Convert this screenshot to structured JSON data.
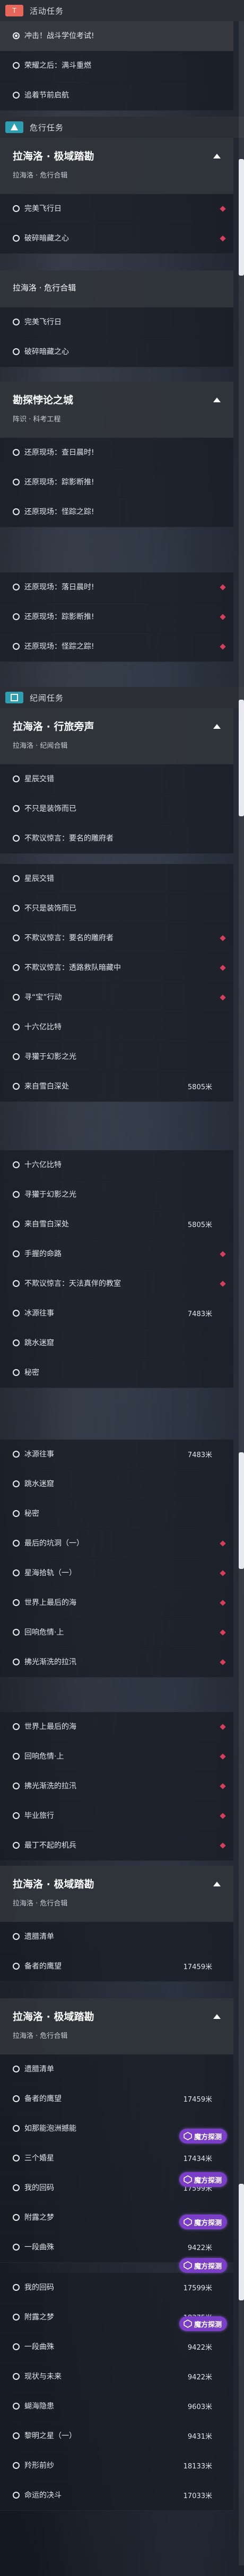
{
  "sections": {
    "activity": {
      "tag": "T",
      "title": "活动任务",
      "tag_color": "#e8665a"
    },
    "danger": {
      "title": "危行任务",
      "tag_color": "#2e9fb0"
    },
    "record": {
      "title": "纪闻任务",
      "tag_color": "#2e9fb0"
    }
  },
  "quest_states": {
    "badge_text": "魔方探测",
    "accent_color": "#d7405a",
    "badge_color": "#7a3fc6"
  },
  "rows": [
    {
      "t": "冲击！战斗学位考试!",
      "sel": true
    },
    {
      "t": "荣耀之后：满斗重燃"
    },
    {
      "t": "追着节前启航"
    },
    {
      "t": "完美飞行日",
      "pin": true
    },
    {
      "t": "破碎暗藏之心",
      "pin": true
    },
    {
      "t": "完美飞行日"
    },
    {
      "t": "破碎暗藏之心"
    },
    {
      "t": "还原现场：查日晨时!",
      "pin": true
    },
    {
      "t": "还原现场：踪影断推!",
      "pin": true
    },
    {
      "t": "还原现场：怪踪之踪!",
      "pin": true
    },
    {
      "t": "还原现场：落日晨时!",
      "pin": true
    },
    {
      "t": "还原现场：踪影断推!",
      "pin": true
    },
    {
      "t": "还原现场：怪踪之踪!",
      "pin": true
    },
    {
      "t": "星辰交错"
    },
    {
      "t": "不只是装饰而已"
    },
    {
      "t": "不欺议惊言：要名的雕府者"
    },
    {
      "t": "星辰交错"
    },
    {
      "t": "不只是装饰而已"
    },
    {
      "t": "不欺议惊言：要名的雕府者",
      "pin": true
    },
    {
      "t": "不欺议惊言：透路救队暗藏中",
      "pin": true
    },
    {
      "t": "寻“宝”行动",
      "pin": true
    },
    {
      "t": "十六亿比特"
    },
    {
      "t": "寻獾于幻影之光"
    },
    {
      "t": "来自雪白深处",
      "d": "5805米"
    },
    {
      "t": "十六亿比特"
    },
    {
      "t": "寻獾于幻影之光"
    },
    {
      "t": "来自雪白深处",
      "d": "5805米"
    },
    {
      "t": "手握的命路",
      "pin": true
    },
    {
      "t": "不欺议惊言：天法真伴的教室",
      "pin": true
    },
    {
      "t": "冰源往事",
      "d": "7483米"
    },
    {
      "t": "跳水迷窟"
    },
    {
      "t": "秘密"
    },
    {
      "t": "冰源往事",
      "d": "7483米"
    },
    {
      "t": "跳水迷窟"
    },
    {
      "t": "秘密"
    },
    {
      "t": "最后的坑洞（一）",
      "pin": true
    },
    {
      "t": "星海拾轨（一）",
      "pin": true
    },
    {
      "t": "世界上最后的海",
      "pin": true
    },
    {
      "t": "回响危情·上",
      "pin": true
    },
    {
      "t": "拂光渐洗的拉汛",
      "pin": true
    },
    {
      "t": "世界上最后的海",
      "pin": true
    },
    {
      "t": "回响危情·上",
      "pin": true
    },
    {
      "t": "拂光渐洗的拉汛",
      "pin": true
    },
    {
      "t": "毕业旅行",
      "pin": true
    },
    {
      "t": "最丁不起的机兵",
      "pin": true
    },
    {
      "t": "遗腊清单"
    },
    {
      "t": "备者的鹰望",
      "d": "17459米"
    },
    {
      "t": "遗腊清单"
    },
    {
      "t": "备者的鹰望",
      "d": "17459米"
    },
    {
      "t": "如那能泡洲撼能"
    },
    {
      "t": "三个婚星",
      "d": "17434米"
    },
    {
      "t": "我的回码",
      "d": "17599米"
    },
    {
      "t": "附露之梦",
      "d": "18375米"
    },
    {
      "t": "一段曲殊",
      "d": "9422米"
    },
    {
      "t": "我的回码",
      "d": "17599米"
    },
    {
      "t": "附露之梦",
      "d": "18375米"
    },
    {
      "t": "一段曲殊",
      "d": "9422米"
    },
    {
      "t": "现状与未来",
      "d": "9422米"
    },
    {
      "t": "蝴海隐患",
      "d": "9603米"
    },
    {
      "t": "黎明之星（一）",
      "d": "9431米"
    },
    {
      "t": "羚形前纱",
      "d": "18133米"
    },
    {
      "t": "命运的决斗",
      "d": "17033米"
    }
  ],
  "cards": [
    {
      "title": "拉海洛 · 极域踏勘",
      "sub": "拉海洛 · 危行合辑"
    },
    {
      "title": "拉海洛 · 危行合辑",
      "sub": ""
    },
    {
      "title": "勘探悖论之城",
      "sub": "阵识 · 科考工程"
    },
    {
      "title": "拉海洛 · 行旅旁声",
      "sub": "拉海洛 · 纪闻合辑"
    },
    {
      "title": "拉海洛 · 极域踏勘",
      "sub": "拉海洛 · 危行合辑"
    },
    {
      "title": "拉海洛 · 极域踏勘",
      "sub": "拉海洛 · 危行合辑"
    }
  ]
}
